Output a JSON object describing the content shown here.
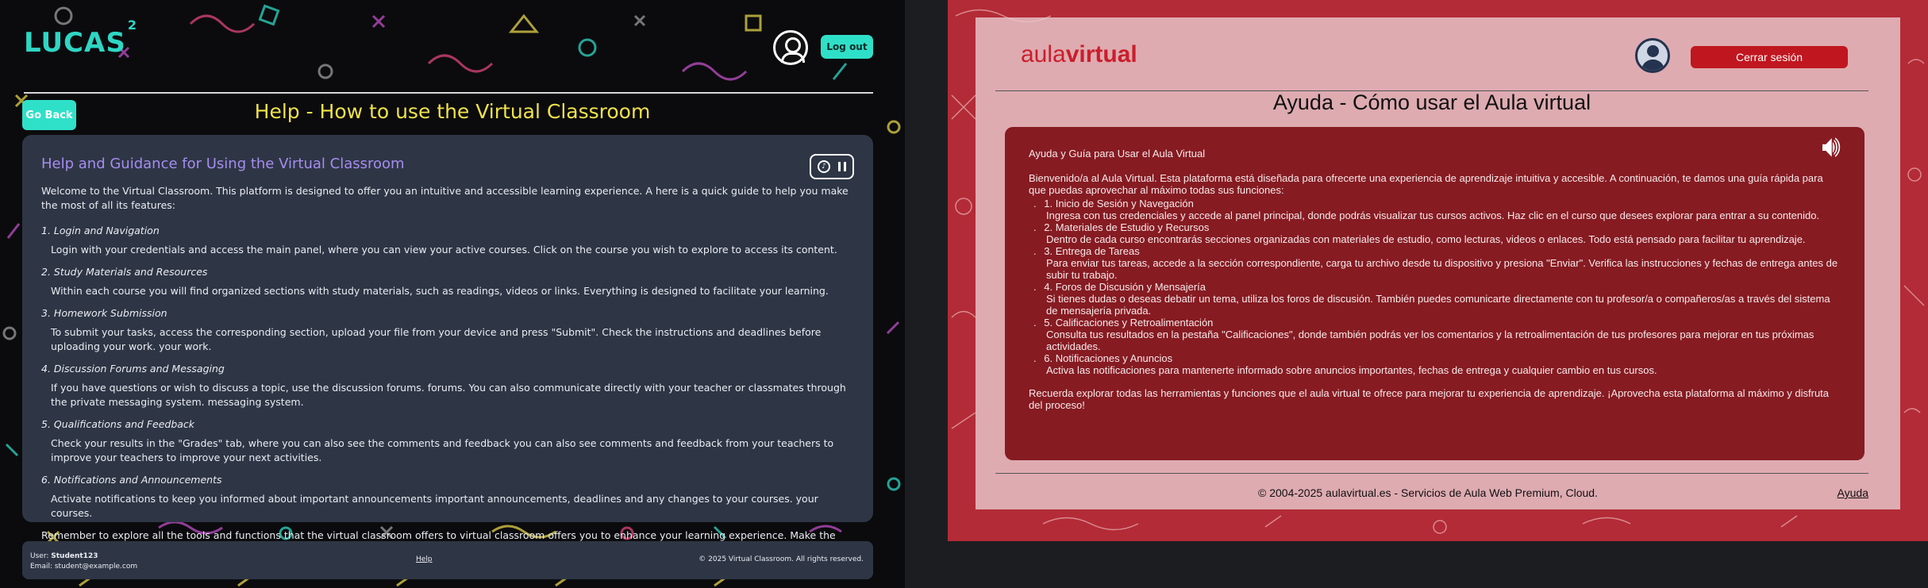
{
  "left": {
    "logo_text": "LUCAS",
    "logo_sup": "2",
    "logout_label": "Log out",
    "go_back_label": "Go Back",
    "page_title": "Help - How to use the Virtual Classroom",
    "card_title": "Help and Guidance for Using the Virtual Classroom",
    "intro": "Welcome to the Virtual Classroom. This platform is designed to offer you an intuitive and accessible learning experience. A here is a quick guide to help you make the most of all its features:",
    "items": [
      {
        "num": "1.",
        "title": "Login and Navigation",
        "desc": "Login with your credentials and access the main panel, where you can view your active courses. Click on the course you wish to explore to access its content."
      },
      {
        "num": "2.",
        "title": "Study Materials and Resources",
        "desc": "Within each course you will find organized sections with study materials, such as readings, videos or links. Everything is designed to facilitate your learning."
      },
      {
        "num": "3.",
        "title": "Homework Submission",
        "desc": "To submit your tasks, access the corresponding section, upload your file from your device and press \"Submit\". Check the instructions and deadlines before uploading your work. your work."
      },
      {
        "num": "4.",
        "title": "Discussion Forums and Messaging",
        "desc": "If you have questions or wish to discuss a topic, use the discussion forums. forums. You can also communicate directly with your teacher or classmates through the private messaging system. messaging system."
      },
      {
        "num": "5.",
        "title": "Qualifications and Feedback",
        "desc": "Check your results in the \"Grades\" tab, where you can also see the comments and feedback you can also see comments and feedback from your teachers to improve your teachers to improve your next activities."
      },
      {
        "num": "6.",
        "title": "Notifications and Announcements",
        "desc": "Activate notifications to keep you informed about important announcements important announcements, deadlines and any changes to your courses. your courses."
      }
    ],
    "outro": "Remember to explore all the tools and functions that the virtual classroom offers to virtual classroom offers you to enhance your learning experience. Make the most of this platform and enjoy the process!",
    "footer": {
      "user_prefix": "User: ",
      "user_name": "Student123",
      "email_line": "Email: student@example.com",
      "help_link": "Help",
      "copyright": "© 2025 Virtual Classroom. All rights reserved."
    }
  },
  "right": {
    "logo_a": "aula",
    "logo_b": "virtual",
    "logout_label": "Cerrar sesión",
    "page_title": "Ayuda - Cómo usar el Aula virtual",
    "card_title": "Ayuda y Guía para Usar el Aula Virtual",
    "intro": "Bienvenido/a al Aula Virtual. Esta plataforma está diseñada para ofrecerte una experiencia de aprendizaje intuitiva y accesible. A continuación, te damos una guía rápida para que puedas aprovechar al máximo todas sus funciones:",
    "items": [
      {
        "num": "1",
        "title": "Inicio de Sesión y Navegación",
        "desc": "Ingresa con tus credenciales y accede al panel principal, donde podrás visualizar tus cursos activos. Haz clic en el curso que desees explorar para entrar a su contenido."
      },
      {
        "num": "2",
        "title": "Materiales de Estudio y Recursos",
        "desc": "Dentro de cada curso encontrarás secciones organizadas con materiales de estudio, como lecturas, videos o enlaces. Todo está pensado para facilitar tu aprendizaje."
      },
      {
        "num": "3",
        "title": "Entrega de Tareas",
        "desc": "Para enviar tus tareas, accede a la sección correspondiente, carga tu archivo desde tu dispositivo y presiona \"Enviar\". Verifica las instrucciones y fechas de entrega antes de subir tu trabajo."
      },
      {
        "num": "4",
        "title": "Foros de Discusión y Mensajería",
        "desc": "Si tienes dudas o deseas debatir un tema, utiliza los foros de discusión. También puedes comunicarte directamente con tu profesor/a o compañeros/as a través del sistema de mensajería privada."
      },
      {
        "num": "5",
        "title": "Calificaciones y Retroalimentación",
        "desc": "Consulta tus resultados en la pestaña \"Calificaciones\", donde también podrás ver los comentarios y la retroalimentación de tus profesores para mejorar en tus próximas actividades."
      },
      {
        "num": "6",
        "title": "Notificaciones y Anuncios",
        "desc": "Activa las notificaciones para mantenerte informado sobre anuncios importantes, fechas de entrega y cualquier cambio en tus cursos."
      }
    ],
    "outro": "Recuerda explorar todas las herramientas y funciones que el aula virtual te ofrece para mejorar tu experiencia de aprendizaje. ¡Aprovecha esta plataforma al máximo y disfruta del proceso!",
    "footer": {
      "copyright": "© 2004-2025 aulavirtual.es - Servicios de Aula Web Premium, Cloud.",
      "help_link": "Ayuda"
    }
  },
  "colors": {
    "left_accent": "#2fe0c8",
    "left_title": "#f0e14a",
    "left_card_title": "#a58cf0",
    "left_card_bg": "#2e3645",
    "right_brand": "#c0161f",
    "right_card_bg": "#861b22"
  }
}
